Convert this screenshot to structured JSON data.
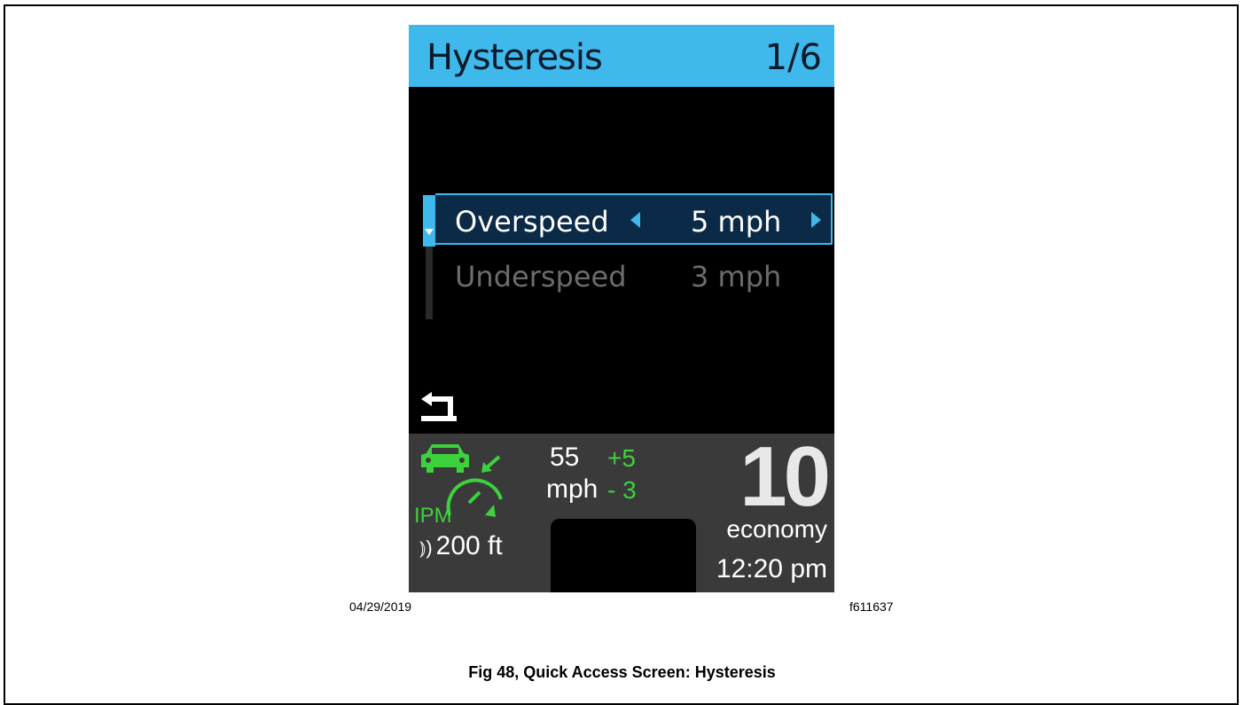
{
  "screen": {
    "title": "Hysteresis",
    "page": "1/6",
    "items": [
      {
        "label": "Overspeed",
        "value": "5 mph",
        "selected": true
      },
      {
        "label": "Underspeed",
        "value": "3 mph",
        "selected": false
      }
    ],
    "back_icon": "back-arrow-icon"
  },
  "status": {
    "ipm_label": "IPM",
    "set_speed": "55",
    "speed_unit": "mph",
    "overspeed_delta": "+5",
    "underspeed_delta": "- 3",
    "gear": "10",
    "mode": "economy",
    "time": "12:20 pm",
    "following_distance": "200 ft"
  },
  "document": {
    "date": "04/29/2019",
    "figure_id": "f611637",
    "caption": "Fig 48, Quick Access Screen: Hysteresis"
  },
  "colors": {
    "accent": "#3fb8eb",
    "selected_row_bg": "#0a2a48",
    "ipm_green": "#3cd23c",
    "status_bg": "#3a3a3a",
    "inactive_text": "#6c6c6c"
  }
}
